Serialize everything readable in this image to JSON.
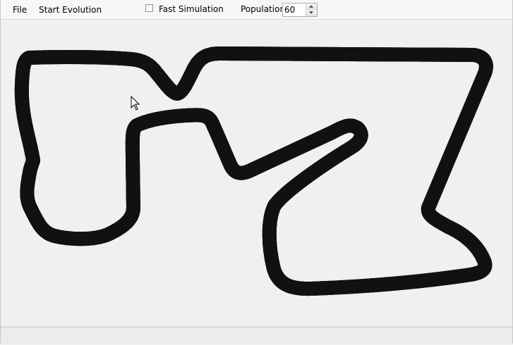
{
  "menu": {
    "file_label": "File",
    "start_evolution_label": "Start Evolution"
  },
  "toolbar": {
    "fast_simulation_label": "Fast Simulation",
    "fast_simulation_checked": false,
    "population_label": "Population",
    "population_value": "60"
  },
  "track": {
    "asphalt_color": "#9c9c9c",
    "border_color": "#111111",
    "center_line_color": "#ffffff",
    "background_color": "#f0f0f0"
  },
  "icons": {
    "cursor": "arrow-cursor-icon"
  }
}
